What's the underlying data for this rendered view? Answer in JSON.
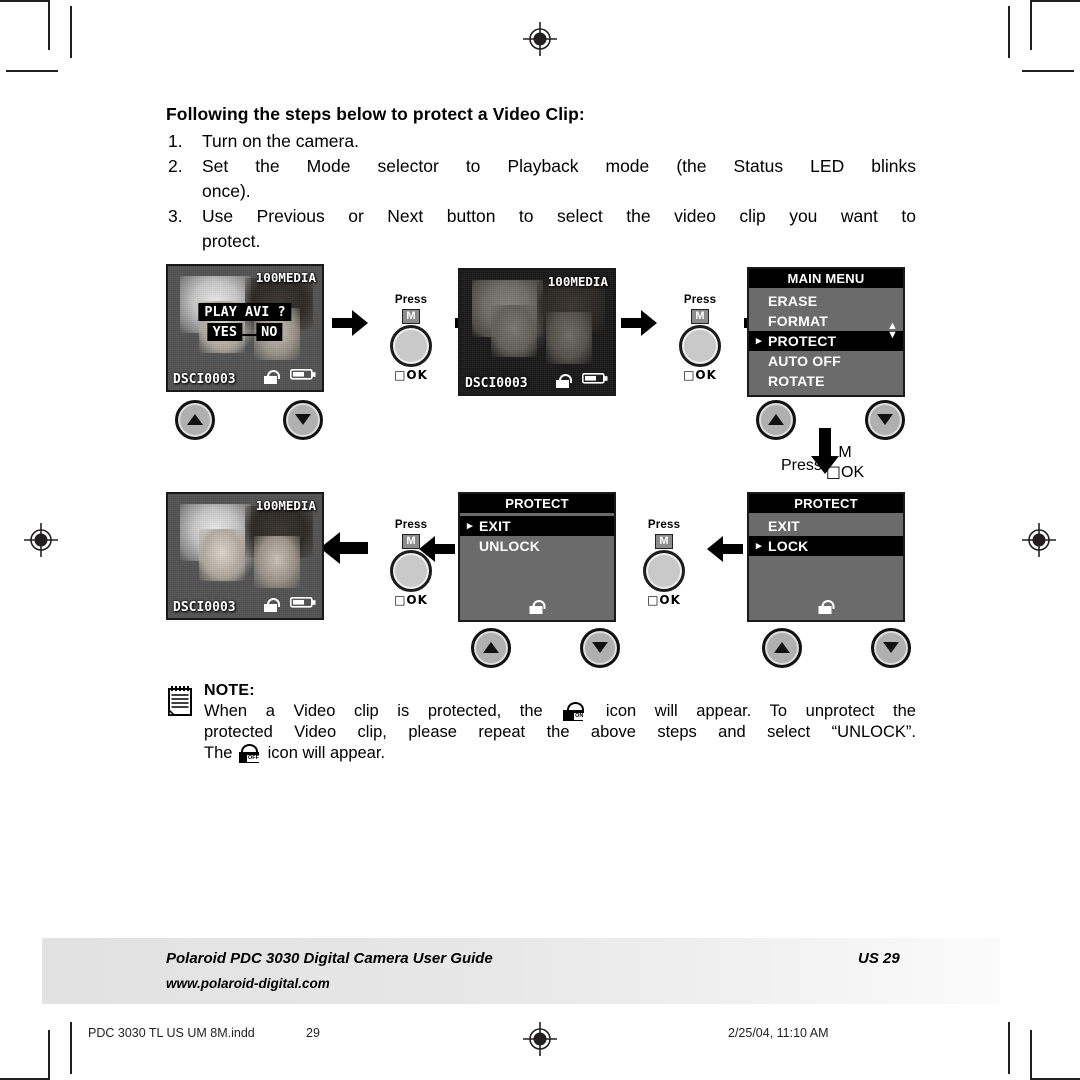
{
  "page": {
    "headline": "Following the steps below to protect a Video Clip:",
    "steps": [
      {
        "num": "1.",
        "text": "Turn on the camera."
      },
      {
        "num": "2.",
        "line1": "Set the Mode selector to Playback mode (the Status LED blinks",
        "line2": "once)."
      },
      {
        "num": "3.",
        "line1": "Use Previous or Next button to select the video clip you want to",
        "line2": "protect."
      }
    ]
  },
  "diagram": {
    "photo1": {
      "media": "100MEDIA",
      "filename": "DSCI0003",
      "prompt": "PLAY AVI ?",
      "yes": "YES",
      "no": "NO"
    },
    "photo2": {
      "media": "100MEDIA",
      "filename": "DSCI0003"
    },
    "photo3": {
      "media": "100MEDIA",
      "filename": "DSCI0003"
    },
    "main_menu": {
      "title": "MAIN MENU",
      "items": [
        "ERASE",
        "FORMAT",
        "PROTECT",
        "AUTO OFF",
        "ROTATE"
      ],
      "selected": "PROTECT",
      "caret": "▸",
      "scroll_up": "▲",
      "scroll_down": "▼"
    },
    "protect_lock": {
      "title": "PROTECT",
      "items": [
        "EXIT",
        "LOCK"
      ],
      "selected": "LOCK",
      "caret": "▸"
    },
    "protect_unlock": {
      "title": "PROTECT",
      "items": [
        "EXIT",
        "UNLOCK"
      ],
      "selected": "EXIT",
      "caret": "▸"
    },
    "press_keys": [
      {
        "label": "Press",
        "badge": "M",
        "ok": "OK"
      },
      {
        "label": "Press",
        "badge": "M",
        "ok": "OK"
      },
      {
        "label": "Press",
        "badge": "M",
        "ok": "OK"
      },
      {
        "label": "Press",
        "badge": "M",
        "ok": "OK"
      },
      {
        "label": "Press",
        "badge": "M",
        "ok": "OK"
      }
    ],
    "lock_on_tag": "ON",
    "lock_off_tag": "OFF"
  },
  "note": {
    "title": "NOTE:",
    "line1a": "When a Video clip is protected, the",
    "line1b": "icon will appear. To unprotect the",
    "line2": "protected Video clip, please repeat the above steps and select “UNLOCK”.",
    "line3a": "The",
    "line3b": "icon will appear."
  },
  "footer": {
    "title": "Polaroid PDC 3030 Digital Camera User Guide",
    "page": "US 29",
    "url": "www.polaroid-digital.com"
  },
  "printline": {
    "left": "PDC 3030 TL US UM 8M.indd",
    "number": "29",
    "right": "2/25/04, 11:10 AM"
  },
  "colors": {
    "ink": "#000000",
    "panel_bg": "#6b6b6b",
    "panel_title_bg": "#000000",
    "footer_bg": "#e6e6e6",
    "knob": "#c9c9c9"
  }
}
